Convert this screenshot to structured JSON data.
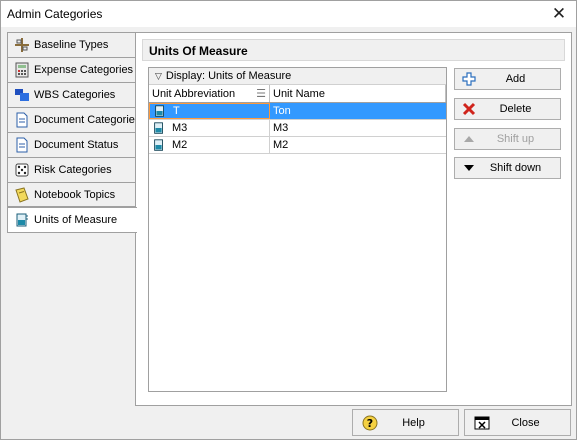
{
  "window": {
    "title": "Admin Categories"
  },
  "tabs": [
    {
      "label": "Baseline Types",
      "icon": "baseline-icon"
    },
    {
      "label": "Expense Categories",
      "icon": "calculator-icon"
    },
    {
      "label": "WBS Categories",
      "icon": "wbs-icon"
    },
    {
      "label": "Document Categories",
      "icon": "document-icon"
    },
    {
      "label": "Document Status",
      "icon": "document-icon"
    },
    {
      "label": "Risk Categories",
      "icon": "dice-icon"
    },
    {
      "label": "Notebook Topics",
      "icon": "notebook-icon"
    },
    {
      "label": "Units of Measure",
      "icon": "beaker-icon"
    }
  ],
  "panel": {
    "title": "Units Of Measure",
    "display_label": "Display: Units of Measure",
    "columns": [
      "Unit Abbreviation",
      "Unit Name"
    ],
    "rows": [
      {
        "abbr": "T",
        "name": "Ton"
      },
      {
        "abbr": "M3",
        "name": "M3"
      },
      {
        "abbr": "M2",
        "name": "M2"
      }
    ]
  },
  "buttons": {
    "add": "Add",
    "delete": "Delete",
    "shift_up": "Shift up",
    "shift_down": "Shift down",
    "help": "Help",
    "close": "Close"
  },
  "colors": {
    "selection": "#3399ff",
    "selection_border": "#ff9a3c",
    "add_icon": "#2a6ebd",
    "delete_icon": "#d0241c"
  }
}
